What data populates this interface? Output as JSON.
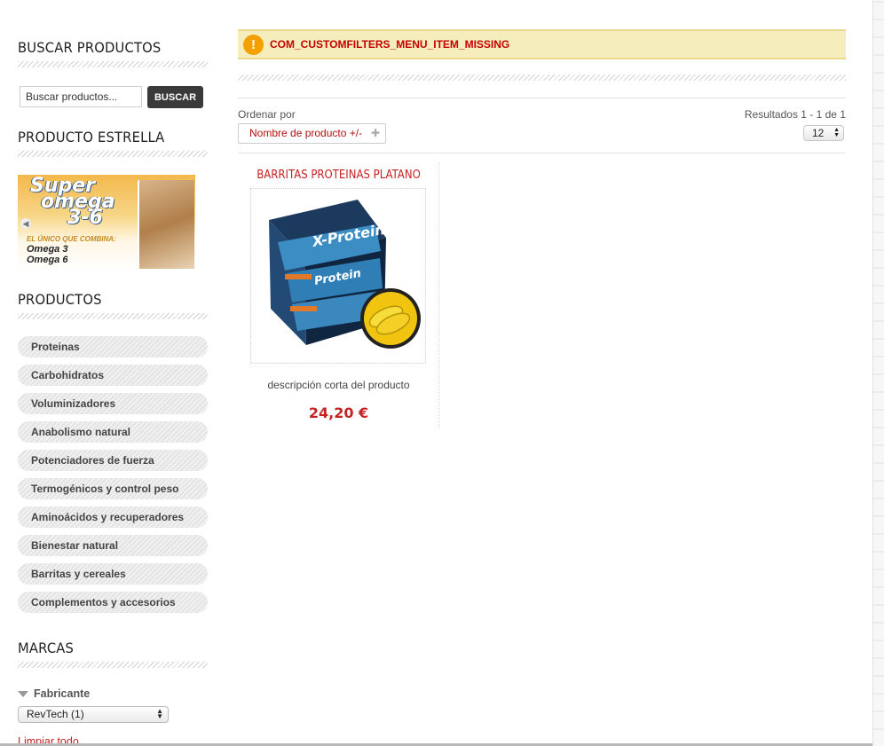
{
  "sidebar": {
    "search": {
      "title": "BUSCAR PRODUCTOS",
      "placeholder": "Buscar productos...",
      "button_label": "BUSCAR"
    },
    "featured": {
      "title": "PRODUCTO ESTRELLA",
      "banner_title_1": "Super",
      "banner_title_2": "omega",
      "banner_title_3": "3-6",
      "banner_tagline": "EL ÚNICO QUE COMBINA:",
      "banner_line_1": "Omega 3",
      "banner_line_2": "Omega 6"
    },
    "categories": {
      "title": "PRODUCTOS",
      "items": [
        "Proteinas",
        "Carbohidratos",
        "Voluminizadores",
        "Anabolismo natural",
        "Potenciadores de fuerza",
        "Termogénicos y control peso",
        "Aminoácidos y recuperadores",
        "Bienestar natural",
        "Barritas y cereales",
        "Complementos y accesorios"
      ]
    },
    "brands": {
      "title": "MARCAS",
      "filter_label": "Fabricante",
      "selected": "RevTech (1)",
      "clear_label": "Limpiar todo"
    }
  },
  "main": {
    "alert_text": "COM_CUSTOMFILTERS_MENU_ITEM_MISSING",
    "order_label": "Ordenar por",
    "order_value": "Nombre de producto +/-",
    "results_text": "Resultados 1 - 1 de 1",
    "limit_value": "12",
    "product": {
      "name": "BARRITAS PROTEINAS PLATANO",
      "description": "descripción corta del producto",
      "price": "24,20 €"
    }
  },
  "colors": {
    "accent_red": "#c62222",
    "alert_bg": "#f6edbd",
    "alert_icon": "#f2a100",
    "button_dark": "#3a3a3a"
  }
}
